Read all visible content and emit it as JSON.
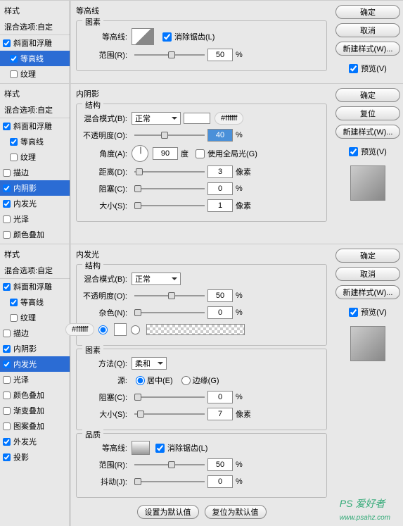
{
  "panel1": {
    "sidebar": {
      "header": "样式",
      "subheader": "混合选项:自定",
      "items": [
        {
          "label": "斜面和浮雕",
          "checked": true,
          "selected": false
        },
        {
          "label": "等高线",
          "checked": true,
          "selected": true
        },
        {
          "label": "纹理",
          "checked": false,
          "selected": false
        }
      ]
    },
    "title": "等高线",
    "group": "图素",
    "contour_label": "等高线:",
    "antialias": "消除锯齿(L)",
    "range_label": "范围(R):",
    "range_value": "50",
    "percent": "%",
    "buttons": {
      "ok": "确定",
      "cancel": "取消",
      "new_style": "新建样式(W)...",
      "preview": "预览(V)"
    }
  },
  "panel2": {
    "sidebar": {
      "header": "样式",
      "subheader": "混合选项:自定",
      "items": [
        {
          "label": "斜面和浮雕",
          "checked": true
        },
        {
          "label": "等高线",
          "checked": true
        },
        {
          "label": "纹理",
          "checked": false
        },
        {
          "label": "描边",
          "checked": false
        },
        {
          "label": "内阴影",
          "checked": true,
          "selected": true
        },
        {
          "label": "内发光",
          "checked": true
        },
        {
          "label": "光泽",
          "checked": false
        },
        {
          "label": "颜色叠加",
          "checked": false
        }
      ]
    },
    "title": "内阴影",
    "group": "结构",
    "blend_label": "混合模式(B):",
    "blend_value": "正常",
    "color_hex": "#ffffff",
    "opacity_label": "不透明度(O):",
    "opacity_value": "40",
    "angle_label": "角度(A):",
    "angle_value": "90",
    "degree": "度",
    "global_light": "使用全局光(G)",
    "distance_label": "距离(D):",
    "distance_value": "3",
    "pixels": "像素",
    "choke_label": "阻塞(C):",
    "choke_value": "0",
    "percent": "%",
    "size_label": "大小(S):",
    "size_value": "1",
    "buttons": {
      "ok": "确定",
      "reset": "复位",
      "new_style": "新建样式(W)...",
      "preview": "预览(V)"
    }
  },
  "panel3": {
    "sidebar": {
      "header": "样式",
      "subheader": "混合选项:自定",
      "items": [
        {
          "label": "斜面和浮雕",
          "checked": true
        },
        {
          "label": "等高线",
          "checked": true
        },
        {
          "label": "纹理",
          "checked": false
        },
        {
          "label": "描边",
          "checked": false
        },
        {
          "label": "内阴影",
          "checked": true
        },
        {
          "label": "内发光",
          "checked": true,
          "selected": true
        },
        {
          "label": "光泽",
          "checked": false
        },
        {
          "label": "颜色叠加",
          "checked": false
        },
        {
          "label": "渐变叠加",
          "checked": false
        },
        {
          "label": "图案叠加",
          "checked": false
        },
        {
          "label": "外发光",
          "checked": true
        },
        {
          "label": "投影",
          "checked": true
        }
      ]
    },
    "title": "内发光",
    "group_struct": "结构",
    "blend_label": "混合模式(B):",
    "blend_value": "正常",
    "opacity_label": "不透明度(O):",
    "opacity_value": "50",
    "noise_label": "杂色(N):",
    "noise_value": "0",
    "color_hex": "#ffffff",
    "group_elem": "图素",
    "method_label": "方法(Q):",
    "method_value": "柔和",
    "source_label": "源:",
    "source_center": "居中(E)",
    "source_edge": "边缘(G)",
    "choke_label": "阻塞(C):",
    "choke_value": "0",
    "size_label": "大小(S):",
    "size_value": "7",
    "group_quality": "品质",
    "contour_label": "等高线:",
    "antialias": "消除锯齿(L)",
    "range_label": "范围(R):",
    "range_value": "50",
    "jitter_label": "抖动(J):",
    "jitter_value": "0",
    "percent": "%",
    "pixels": "像素",
    "set_default": "设置为默认值",
    "reset_default": "复位为默认值",
    "buttons": {
      "ok": "确定",
      "cancel": "取消",
      "new_style": "新建样式(W)...",
      "preview": "预览(V)"
    },
    "watermark": "PS 爱好者",
    "watermark_url": "www.psahz.com"
  }
}
